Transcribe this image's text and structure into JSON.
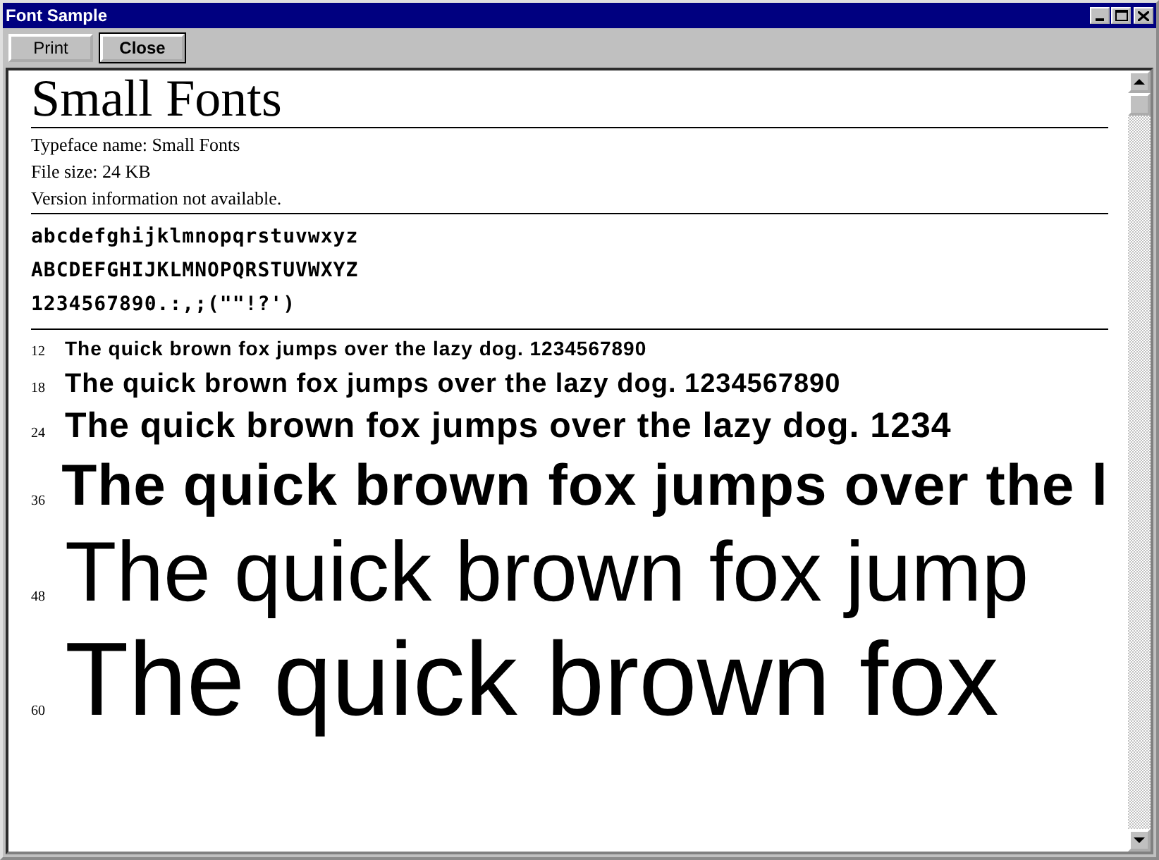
{
  "window": {
    "title": "Font Sample"
  },
  "buttons": [
    {
      "label": "Print",
      "default": false
    },
    {
      "label": "Close",
      "default": true
    }
  ],
  "font": {
    "name": "Small Fonts",
    "info": [
      "Typeface name: Small Fonts",
      "File size: 24 KB",
      "Version information not available."
    ],
    "charset": [
      "abcdefghijklmnopqrstuvwxyz",
      "ABCDEFGHIJKLMNOPQRSTUVWXYZ",
      "1234567890.:,;(\"\"!?')"
    ]
  },
  "samples": [
    {
      "size": "12",
      "text": "The quick brown fox jumps over the lazy dog. 1234567890"
    },
    {
      "size": "18",
      "text": "The quick brown fox jumps over the lazy dog. 1234567890"
    },
    {
      "size": "24",
      "text": "The quick brown fox jumps over the lazy dog. 1234"
    },
    {
      "size": "36",
      "text": "The quick brown fox jumps over the l"
    },
    {
      "size": "48",
      "text": "The quick brown fox jump"
    },
    {
      "size": "60",
      "text": "The quick brown fox"
    }
  ]
}
